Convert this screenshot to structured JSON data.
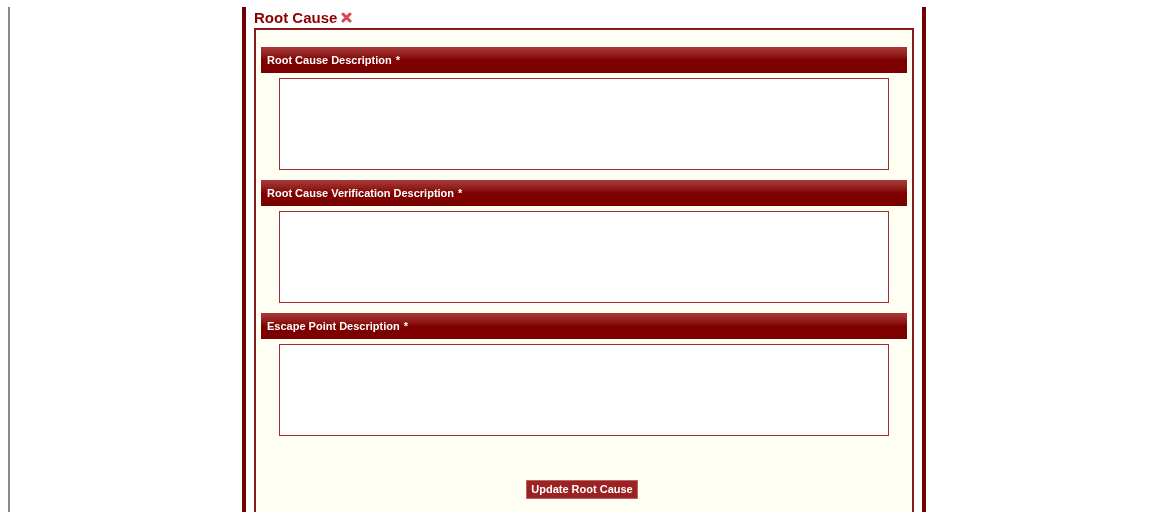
{
  "panel": {
    "title": "Root Cause"
  },
  "sections": [
    {
      "label": "Root Cause Description",
      "required_mark": "*"
    },
    {
      "label": "Root Cause Verification Description",
      "required_mark": "*"
    },
    {
      "label": "Escape Point Description",
      "required_mark": "*"
    }
  ],
  "submit_button": "Update Root Cause"
}
